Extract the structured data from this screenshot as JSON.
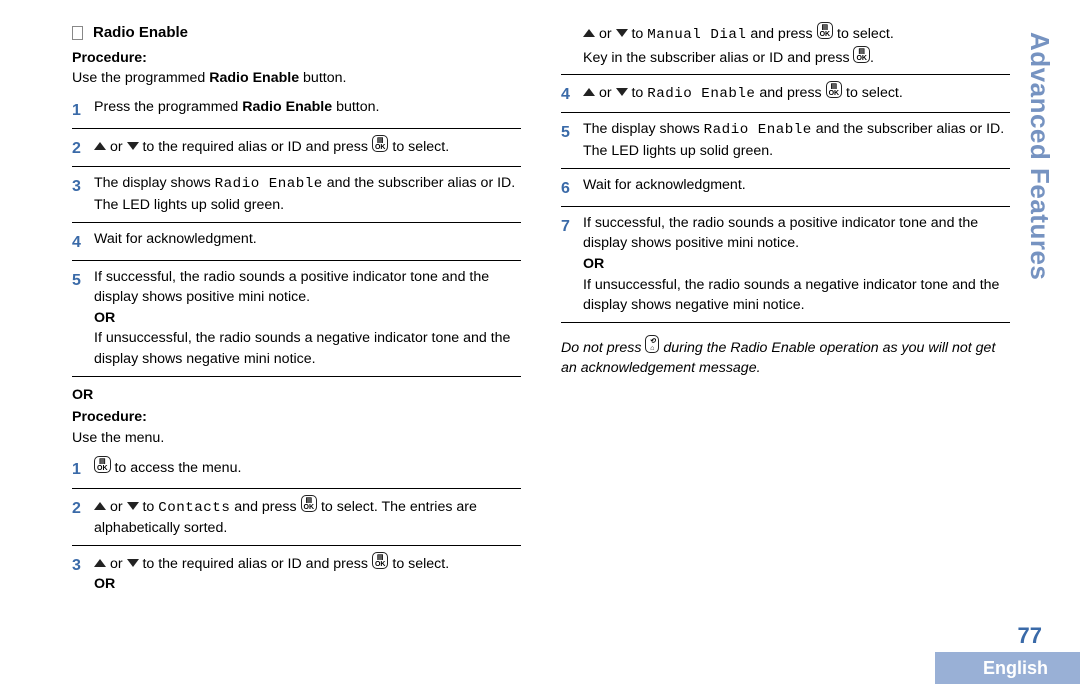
{
  "sideTab": "Advanced Features",
  "pageNumber": "77",
  "language": "English",
  "heading": "Radio Enable",
  "procLabel": "Procedure:",
  "intro1": "Use the programmed ",
  "intro1b": "Radio Enable",
  "intro1c": " button.",
  "orWord": "OR",
  "intro2": "Use the menu.",
  "toSelect": " to select.",
  "orText": " or ",
  "toWord": " to ",
  "andPress": " and press ",
  "left": {
    "s1a": "Press the programmed ",
    "s1b": "Radio Enable",
    "s1c": " button.",
    "s2a": " to the required alias or ID and press ",
    "s3a": " The display shows ",
    "s3b": "Radio Enable",
    "s3c": " and the subscriber alias or ID. The LED lights up solid green.",
    "s4": "Wait for acknowledgment.",
    "s5a": "If successful, the radio sounds a positive indicator tone and the display shows positive mini notice.",
    "s5b": "If unsuccessful, the radio sounds a negative indicator tone and the display shows negative mini notice."
  },
  "left2": {
    "s1": " to access the menu.",
    "s2a": "Contacts",
    "s2b": " to select. The entries are alphabetically sorted.",
    "s3": " to the required alias or ID and press "
  },
  "right": {
    "r0a": "Manual Dial",
    "r0b": "Key in the subscriber alias or ID and press ",
    "r4a": "Radio Enable",
    "r5a": " The display shows ",
    "r5b": "Radio Enable",
    "r5c": " and the subscriber alias or ID. The LED lights up solid green.",
    "r6": "Wait for acknowledgment.",
    "r7a": "If successful, the radio sounds a positive indicator tone and the display shows positive mini notice.",
    "r7b": "If unsuccessful, the radio sounds a negative indicator tone and the display shows negative mini notice."
  },
  "note1": "Do not press ",
  "note2": " during the Radio Enable operation as you will not get an acknowledgement message.",
  "okGlyph1": "▤",
  "okGlyph2": "OK",
  "backGlyph1": "⟲",
  "backGlyph2": "⌂"
}
